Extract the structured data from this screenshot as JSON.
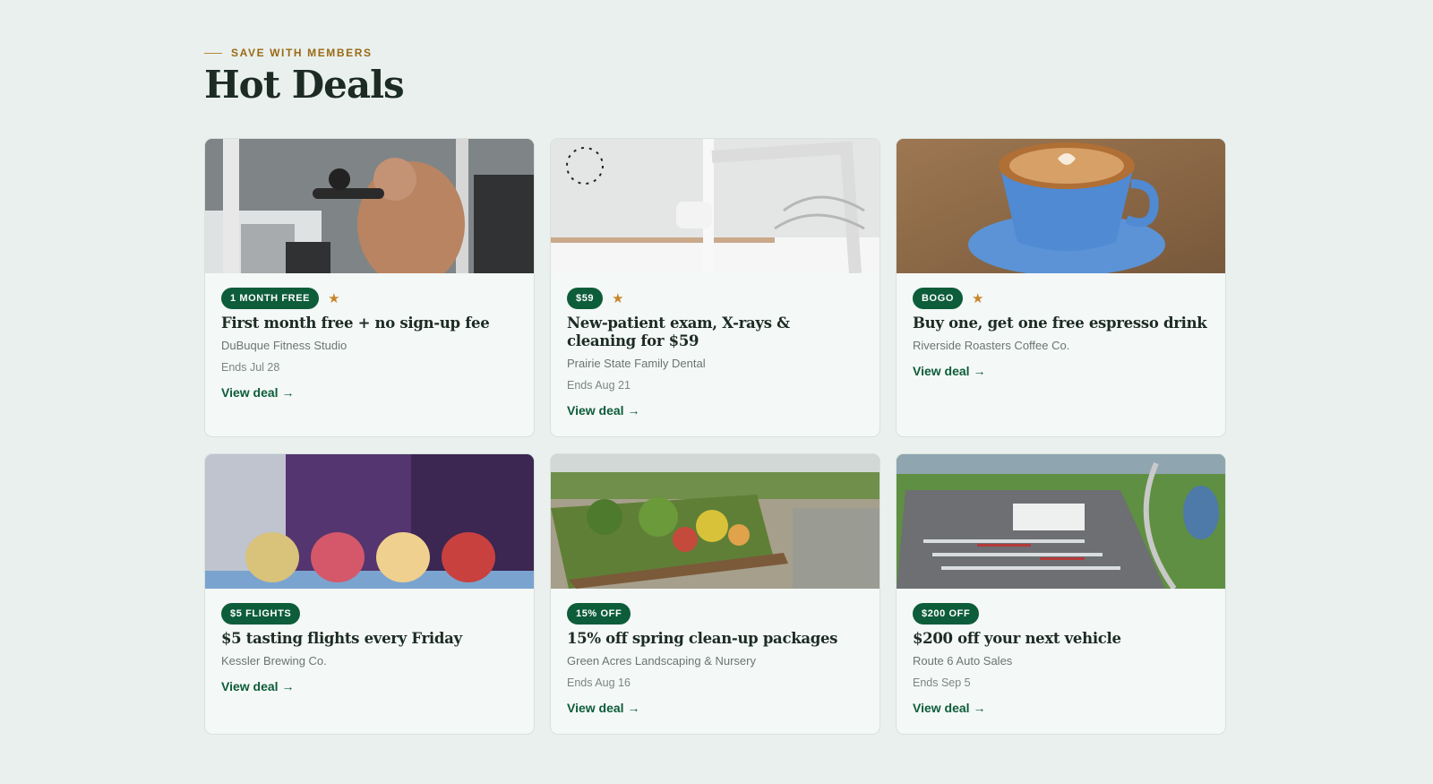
{
  "header": {
    "eyebrow": "SAVE WITH MEMBERS",
    "title": "Hot Deals"
  },
  "colors": {
    "accent_green": "#0d5c3a",
    "star_gold": "#c9862b",
    "eyebrow_gold": "#9a6a15",
    "page_bg": "#eaf0ee"
  },
  "deals": [
    {
      "image_subject": "gym-photo",
      "badge": "1 MONTH FREE",
      "featured": true,
      "title": "First month free + no sign-up fee",
      "merchant": "DuBuque Fitness Studio",
      "ends": "Ends Jul 28",
      "link": "View deal →"
    },
    {
      "image_subject": "dental-office-photo",
      "badge": "$59",
      "featured": true,
      "title": "New-patient exam, X-rays & cleaning for $59",
      "merchant": "Prairie State Family Dental",
      "ends": "Ends Aug 21",
      "link": "View deal →"
    },
    {
      "image_subject": "espresso-cup-photo",
      "badge": "BOGO",
      "featured": true,
      "title": "Buy one, get one free espresso drink",
      "merchant": "Riverside Roasters Coffee Co.",
      "ends": "",
      "link": "View deal →"
    },
    {
      "image_subject": "beer-flight-photo",
      "badge": "$5 FLIGHTS",
      "featured": false,
      "title": "$5 tasting flights every Friday",
      "merchant": "Kessler Brewing Co.",
      "ends": "",
      "link": "View deal →"
    },
    {
      "image_subject": "garden-nursery-photo",
      "badge": "15% OFF",
      "featured": false,
      "title": "15% off spring clean-up packages",
      "merchant": "Green Acres Landscaping & Nursery",
      "ends": "Ends Aug 16",
      "link": "View deal →"
    },
    {
      "image_subject": "car-dealership-aerial-photo",
      "badge": "$200 OFF",
      "featured": false,
      "title": "$200 off your next vehicle",
      "merchant": "Route 6 Auto Sales",
      "ends": "Ends Sep 5",
      "link": "View deal →"
    }
  ]
}
